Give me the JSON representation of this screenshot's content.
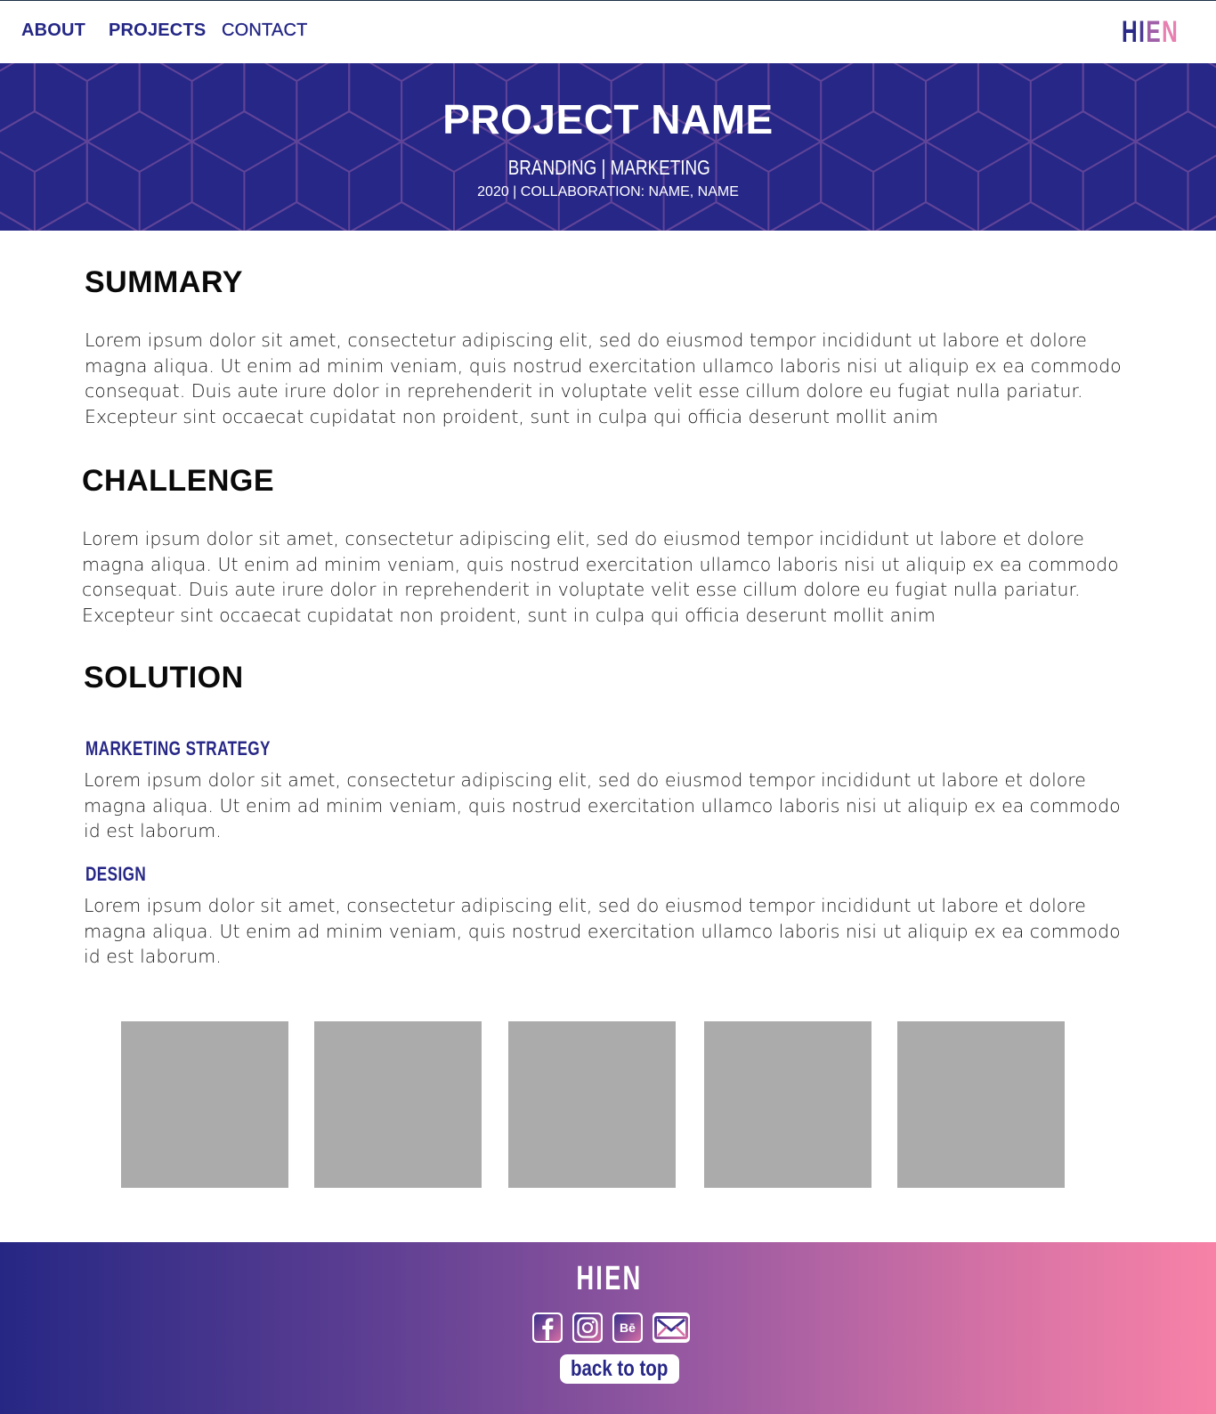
{
  "nav": {
    "links": [
      "ABOUT",
      "PROJECTS",
      "CONTACT"
    ],
    "logo": [
      "H",
      "I",
      "E",
      "N"
    ]
  },
  "hero": {
    "title": "PROJECT NAME",
    "tags": "BRANDING | MARKETING",
    "meta": "2020 | COLLABORATION: NAME, NAME"
  },
  "summary": {
    "title": "SUMMARY",
    "text": "Lorem ipsum dolor sit amet, consectetur adipiscing elit, sed do eiusmod tempor incididunt ut labore et dolore magna aliqua. Ut enim ad minim veniam, quis nostrud exercitation ullamco laboris nisi ut aliquip ex ea commodo consequat. Duis aute irure dolor in reprehenderit in voluptate velit esse cillum dolore eu fugiat nulla pariatur. Excepteur sint occaecat cupidatat non proident, sunt in culpa qui officia deserunt mollit anim"
  },
  "challenge": {
    "title": "CHALLENGE",
    "text": "Lorem ipsum dolor sit amet, consectetur adipiscing elit, sed do eiusmod tempor incididunt ut labore et dolore magna aliqua. Ut enim ad minim veniam, quis nostrud exercitation ullamco laboris nisi ut aliquip ex ea commodo consequat. Duis aute irure dolor in reprehenderit in voluptate velit esse cillum dolore eu fugiat nulla pariatur. Excepteur sint occaecat cupidatat non proident, sunt in culpa qui officia deserunt mollit anim"
  },
  "solution": {
    "title": "SOLUTION",
    "items": [
      {
        "heading": "MARKETING STRATEGY",
        "text": "Lorem ipsum dolor sit amet, consectetur adipiscing elit, sed do eiusmod tempor incididunt ut labore et dolore magna aliqua. Ut enim ad minim veniam, quis nostrud exercitation ullamco laboris nisi ut aliquip ex ea commodo id est laborum."
      },
      {
        "heading": "DESIGN",
        "text": "Lorem ipsum dolor sit amet, consectetur adipiscing elit, sed do eiusmod tempor incididunt ut labore et dolore magna aliqua. Ut enim ad minim veniam, quis nostrud exercitation ullamco laboris nisi ut aliquip ex ea commodo id est laborum."
      }
    ]
  },
  "gallery": {
    "count": 5,
    "placeholder_color": "#ababab"
  },
  "footer": {
    "logo": "HIEN",
    "social": [
      {
        "icon": "facebook-icon",
        "label": "f"
      },
      {
        "icon": "instagram-icon",
        "label": ""
      },
      {
        "icon": "behance-icon",
        "label": "Bē"
      },
      {
        "icon": "email-icon",
        "label": ""
      }
    ],
    "back_to_top": "back to top"
  },
  "colors": {
    "brand_navy": "#272787",
    "brand_pink": "#f882a7",
    "placeholder_gray": "#ababab"
  }
}
